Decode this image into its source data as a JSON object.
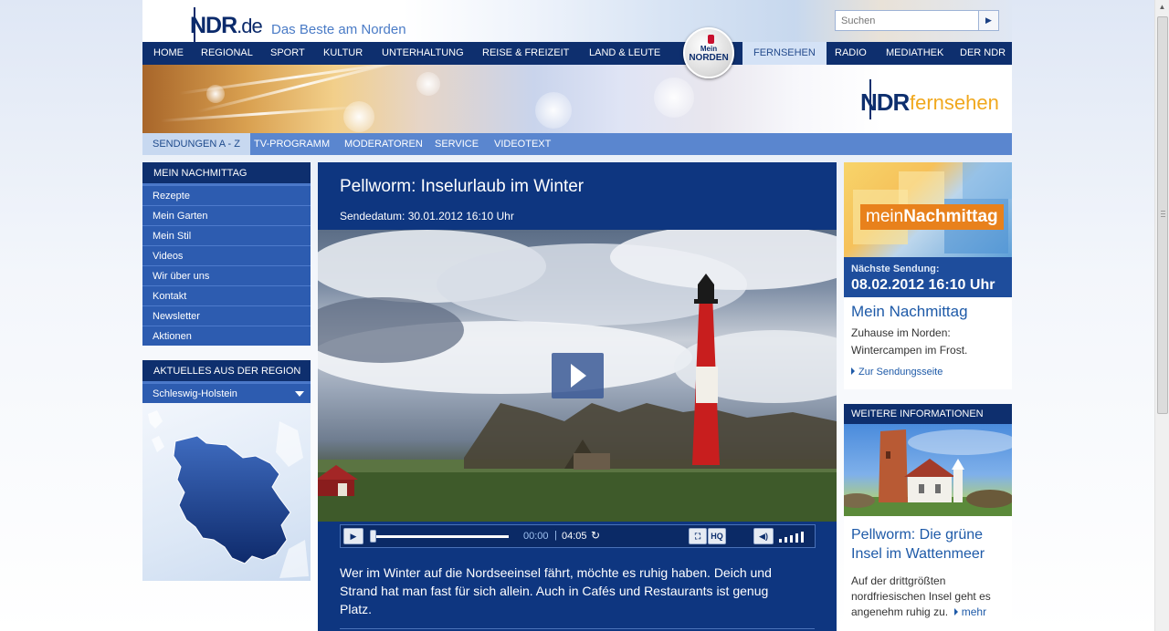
{
  "header": {
    "logo_ndr": "NDR",
    "logo_de": ".de",
    "slogan": "Das Beste am Norden",
    "search_placeholder": "Suchen"
  },
  "main_nav": [
    "HOME",
    "REGIONAL",
    "SPORT",
    "KULTUR",
    "UNTERHALTUNG",
    "REISE & FREIZEIT",
    "LAND & LEUTE",
    "FERNSEHEN",
    "RADIO",
    "MEDIATHEK",
    "DER NDR"
  ],
  "main_nav_active": "FERNSEHEN",
  "mein_norden": {
    "line1": "Mein",
    "line2": "NORDEN"
  },
  "channel_logo": {
    "ndr": "NDR",
    "word": "fernsehen"
  },
  "sub_nav": [
    "SENDUNGEN A - Z",
    "TV-PROGRAMM",
    "MODERATOREN",
    "SERVICE",
    "VIDEOTEXT"
  ],
  "sub_nav_active": "SENDUNGEN A - Z",
  "sidebar": {
    "title": "MEIN NACHMITTAG",
    "items": [
      "Rezepte",
      "Mein Garten",
      "Mein Stil",
      "Videos",
      "Wir über uns",
      "Kontakt",
      "Newsletter",
      "Aktionen"
    ]
  },
  "region": {
    "title": "AKTUELLES AUS DER REGION",
    "selected": "Schleswig-Holstein"
  },
  "article": {
    "title": "Pellworm: Inselurlaub im Winter",
    "date": "Sendedatum: 30.01.2012 16:10 Uhr",
    "teaser": "Wer im Winter auf die Nordseeinsel fährt, möchte es ruhig haben. Deich und Strand hat man fast für sich allein. Auch in Cafés und Restaurants ist genug Platz."
  },
  "player": {
    "time_current": "00:00",
    "time_separator": "|",
    "time_total": "04:05",
    "hq_label": "HQ",
    "progress": 0,
    "volume_level": 5
  },
  "show_teaser": {
    "logo_prefix": "mein",
    "logo_main": "Nachmittag",
    "next_label": "Nächste Sendung:",
    "next_date": "08.02.2012 16:10 Uhr",
    "title": "Mein Nachmittag",
    "description": "Zuhause im Norden: Wintercampen im Frost.",
    "link": "Zur Sendungsseite"
  },
  "more_info": {
    "title": "WEITERE INFORMATIONEN",
    "headline": "Pellworm: Die grüne Insel im Wattenmeer",
    "description": "Auf der drittgrößten nordfriesischen Insel geht es angenehm ruhig zu.",
    "more_link": "mehr"
  },
  "colors": {
    "nav_dark": "#0e2f6e",
    "subnav": "#5a86cf",
    "content_blue": "#0e3680",
    "sidebar_item": "#2d5cb0",
    "link_blue": "#1e5aa8",
    "orange": "#f0a81e"
  }
}
